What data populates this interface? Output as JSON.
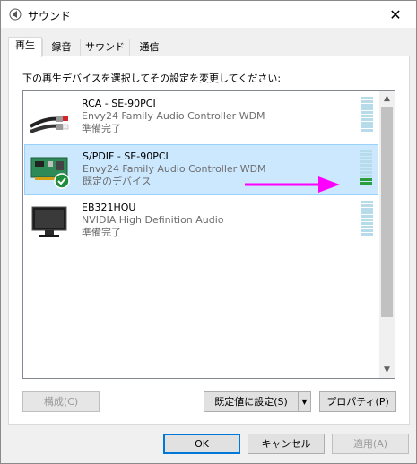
{
  "window": {
    "title": "サウンド",
    "close_label": "✕"
  },
  "tabs": [
    {
      "label": "再生"
    },
    {
      "label": "録音"
    },
    {
      "label": "サウンド"
    },
    {
      "label": "通信"
    }
  ],
  "instruction": "下の再生デバイスを選択してその設定を変更してください:",
  "devices": [
    {
      "name": "RCA - SE-90PCI",
      "driver": "Envy24 Family Audio Controller WDM",
      "status": "準備完了",
      "icon": "rca-cable-icon",
      "level": 0
    },
    {
      "name": "S/PDIF - SE-90PCI",
      "driver": "Envy24 Family Audio Controller WDM",
      "status": "既定のデバイス",
      "icon": "sound-card-icon",
      "level": 0.2
    },
    {
      "name": "EB321HQU",
      "driver": "NVIDIA High Definition Audio",
      "status": "準備完了",
      "icon": "monitor-icon",
      "level": 0
    }
  ],
  "buttons": {
    "configure": "構成(C)",
    "set_default": "既定値に設定(S)",
    "properties": "プロパティ(P)",
    "ok": "OK",
    "cancel": "キャンセル",
    "apply": "適用(A)"
  },
  "colors": {
    "selection": "#cce8ff",
    "level_on": "#2a9d3c",
    "annotation_arrow": "#ff00ff"
  }
}
